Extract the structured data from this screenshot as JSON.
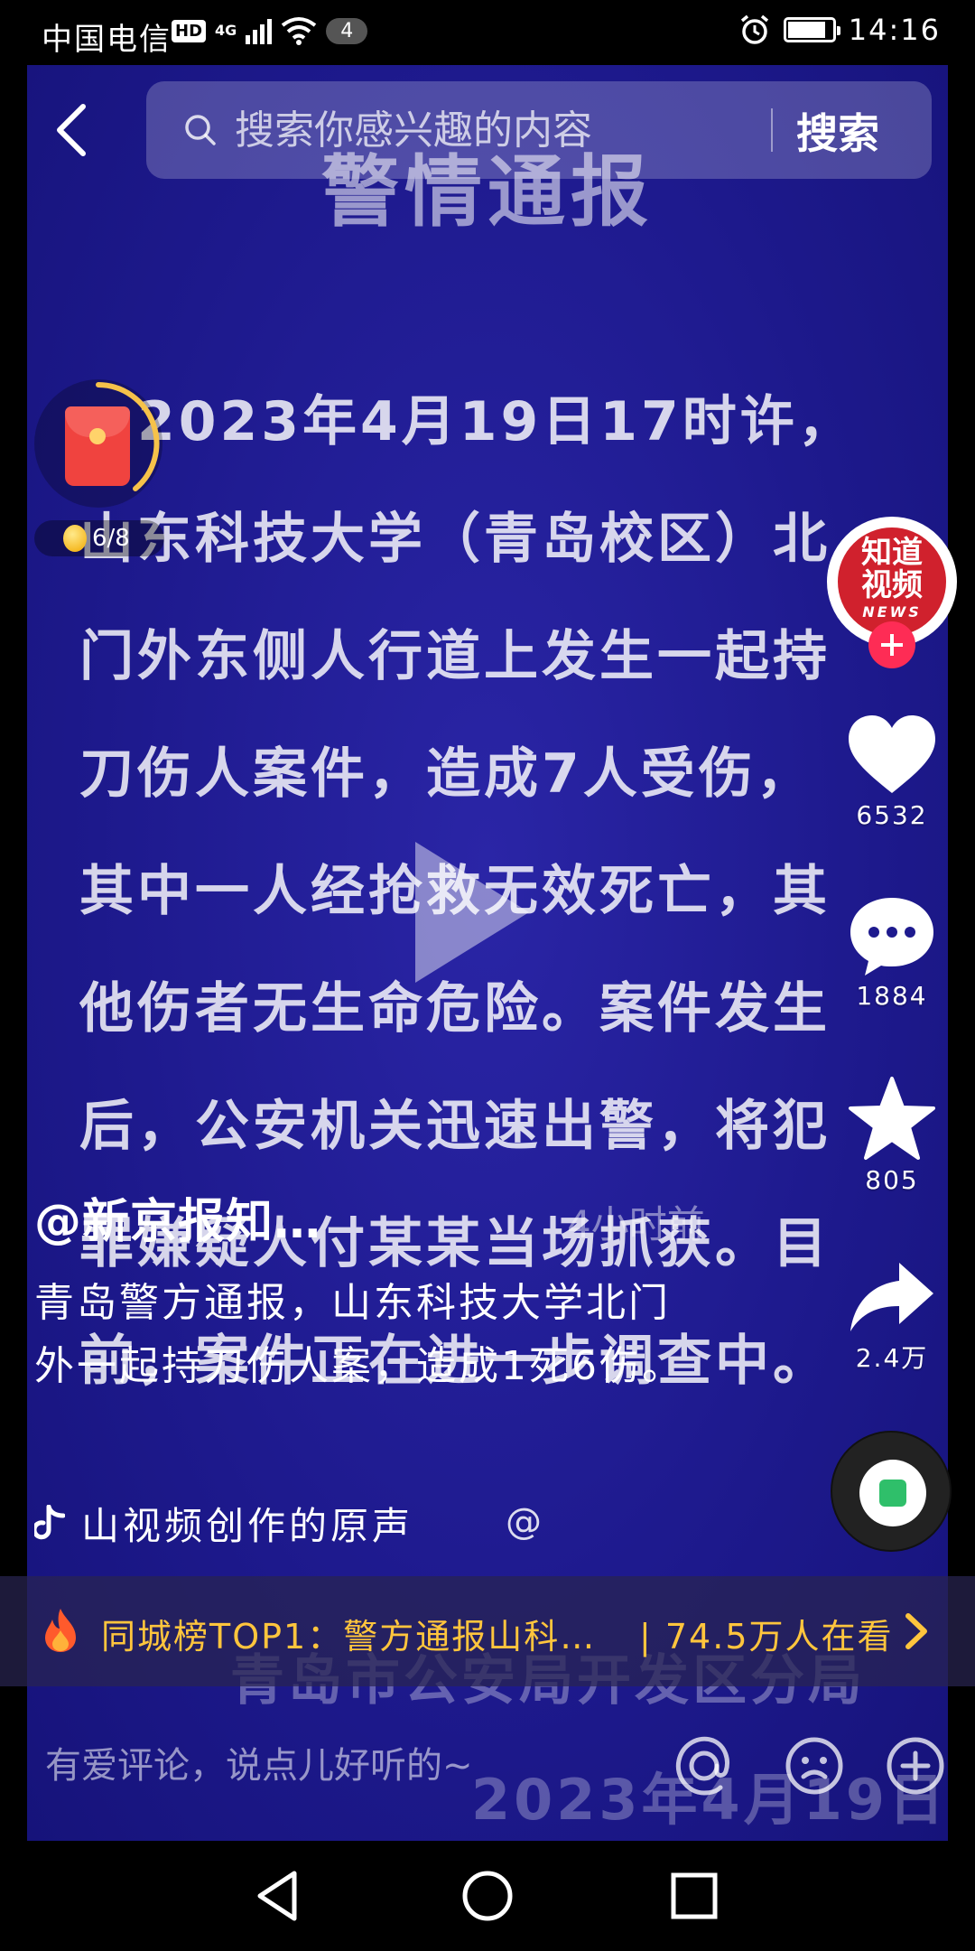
{
  "status_bar": {
    "carrier": "中国电信",
    "hd": "HD",
    "network": "4G",
    "notification_count": "4",
    "battery_level": 0.85,
    "time": "14:16"
  },
  "video_background": {
    "title": "警情通报",
    "body_lines": [
      "　2023年4月19日17时许，",
      "山东科技大学（青岛校区）北",
      "门外东侧人行道上发生一起持",
      "刀伤人案件，造成7人受伤，",
      "其中一人经抢救无效死亡，其",
      "他伤者无生命危险。案件发生",
      "后，公安机关迅速出警，将犯",
      "罪嫌疑人付某某当场抓获。目",
      "前，案件正在进一步调查中。"
    ],
    "footer_org": "青岛市公安局开发区分局",
    "footer_date": "2023年4月19日"
  },
  "search": {
    "placeholder": "搜索你感兴趣的内容",
    "button_label": "搜索"
  },
  "red_packet": {
    "progress": "6/8"
  },
  "creator": {
    "avatar_text_top": "知道",
    "avatar_text_bottom": "视频",
    "avatar_news": "NEWS"
  },
  "actions": {
    "likes": "6532",
    "comments": "1884",
    "favorites": "805",
    "shares": "2.4万"
  },
  "post": {
    "author": "@新京报知…",
    "time_ago": "4小时前",
    "description": "青岛警方通报，山东科技大学北门外一起持刀伤人案，造成1死6伤。",
    "music": "山视频创作的原声",
    "music_scroll": "@"
  },
  "hot_banner": {
    "title": "同城榜TOP1：警方通报山科…",
    "viewers": "| 74.5万人在看"
  },
  "comment_bar": {
    "placeholder": "有爱评论，说点儿好听的~"
  },
  "colors": {
    "video_bg": "#1e1a8e",
    "accent_red": "#fe2c55",
    "banner_text": "#ffc53d"
  }
}
